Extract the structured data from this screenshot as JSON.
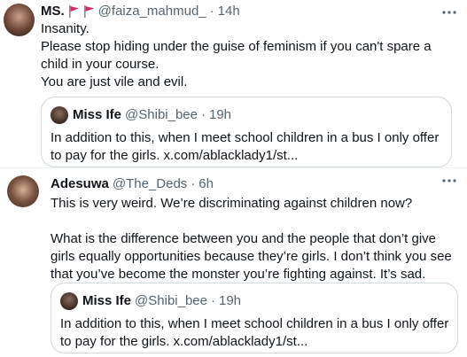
{
  "tweets": [
    {
      "name": "MS.",
      "handle": "@faiza_mahmud_",
      "dot": "·",
      "time": "14h",
      "flag_color": "#e0245e",
      "paragraphs": [
        "Insanity.",
        "Please stop hiding under the guise of feminism if you can't spare a child in your course.",
        "You are just vile and evil."
      ],
      "quote": {
        "name": "Miss Ife",
        "handle": "@Shibi_bee",
        "dot": "·",
        "time": "19h",
        "text": "In addition to this, when I meet school children in a bus I only offer to pay for the girls. x.com/ablacklady1/st..."
      }
    },
    {
      "name": "Adesuwa",
      "handle": "@The_Deds",
      "dot": "·",
      "time": "6h",
      "paragraphs": [
        "This is very weird. We’re discriminating against children now?",
        "What is the difference between you and the people that don’t give girls equally opportunities because they’re girls. I don’t think you see that you’ve become the monster you’re fighting against. It’s sad."
      ],
      "quote": {
        "name": "Miss Ife",
        "handle": "@Shibi_bee",
        "dot": "·",
        "time": "19h",
        "text": "In addition to this, when I meet school children in a bus I only offer to pay for the girls. x.com/ablacklady1/st..."
      }
    }
  ],
  "icons": {
    "more": "more-horizontal-icon",
    "flag": "red-flag-icon"
  },
  "colors": {
    "text": "#0f1419",
    "secondary": "#536471",
    "border": "#cfd9de",
    "flag": "#e0245e"
  }
}
